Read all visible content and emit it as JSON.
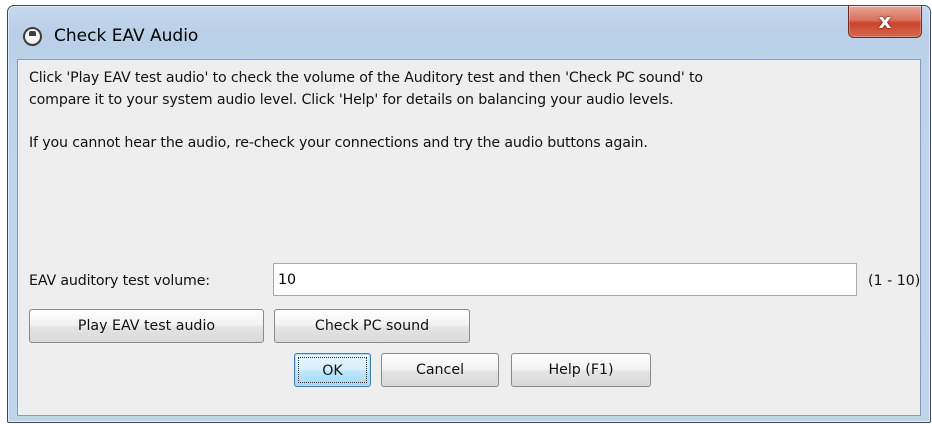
{
  "window": {
    "title": "Check EAV Audio",
    "close_glyph": "x"
  },
  "message": {
    "line1": "Click 'Play EAV test audio' to check the volume of the Auditory test and then 'Check PC sound' to",
    "line2": "compare it to your system audio level. Click 'Help' for details on balancing your audio levels.",
    "line3": "If you cannot hear the audio, re-check your connections and try the audio buttons again."
  },
  "volume": {
    "label": "EAV auditory test volume:",
    "value": "10",
    "range": "(1 - 10)"
  },
  "audio_buttons": {
    "play": "Play EAV test audio",
    "check": "Check PC sound"
  },
  "dialog_buttons": {
    "ok": "OK",
    "cancel": "Cancel",
    "help": "Help (F1)"
  },
  "colors": {
    "frame": "#bcd3ea",
    "client_bg": "#eeeeee",
    "close_red": "#c8442c"
  },
  "icons": {
    "title": "app-window-icon",
    "close": "close-icon"
  }
}
